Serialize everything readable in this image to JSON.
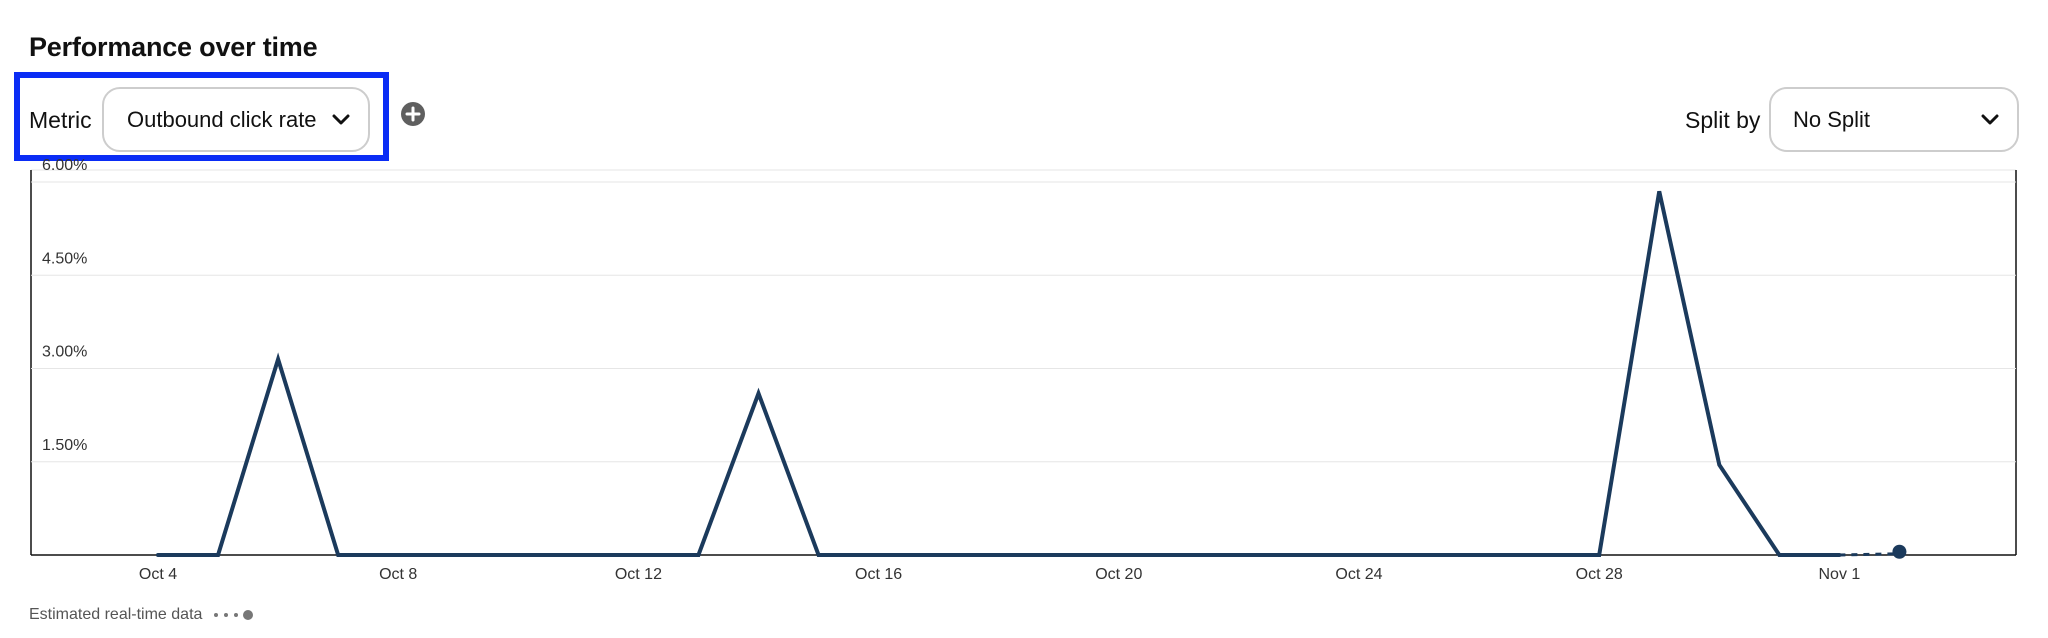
{
  "header": {
    "title": "Performance over time"
  },
  "controls": {
    "metric_label": "Metric",
    "metric_value": "Outbound click rate",
    "split_label": "Split by",
    "split_value": "No Split"
  },
  "legend": {
    "estimated_label": "Estimated real-time data"
  },
  "colors": {
    "line": "#1b3a5c",
    "highlight": "#0a2cf5",
    "grid": "#e6e6e6",
    "axis": "#111111"
  },
  "chart_data": {
    "type": "line",
    "x_tick_labels": [
      "Oct 4",
      "Oct 8",
      "Oct 12",
      "Oct 16",
      "Oct 20",
      "Oct 24",
      "Oct 28",
      "Nov 1"
    ],
    "x": [
      "Oct 4",
      "Oct 5",
      "Oct 6",
      "Oct 7",
      "Oct 8",
      "Oct 9",
      "Oct 10",
      "Oct 11",
      "Oct 12",
      "Oct 13",
      "Oct 14",
      "Oct 15",
      "Oct 16",
      "Oct 17",
      "Oct 18",
      "Oct 19",
      "Oct 20",
      "Oct 21",
      "Oct 22",
      "Oct 23",
      "Oct 24",
      "Oct 25",
      "Oct 26",
      "Oct 27",
      "Oct 28",
      "Oct 29",
      "Oct 30",
      "Oct 31",
      "Nov 1",
      "Nov 2"
    ],
    "values": [
      0,
      0,
      3.15,
      0,
      0,
      0,
      0,
      0,
      0,
      0,
      2.6,
      0,
      0,
      0,
      0,
      0,
      0,
      0,
      0,
      0,
      0,
      0,
      0,
      0,
      0,
      5.85,
      1.45,
      0,
      0,
      0.02
    ],
    "estimated": {
      "x": [
        "Nov 1",
        "Nov 2"
      ],
      "values": [
        0,
        0.02
      ]
    },
    "y_tick_labels": [
      "1.50%",
      "3.00%",
      "4.50%",
      "6.00%"
    ],
    "y_ticks": [
      1.5,
      3.0,
      4.5,
      6.0
    ],
    "ylim": [
      0,
      6.0
    ],
    "grid": true
  }
}
